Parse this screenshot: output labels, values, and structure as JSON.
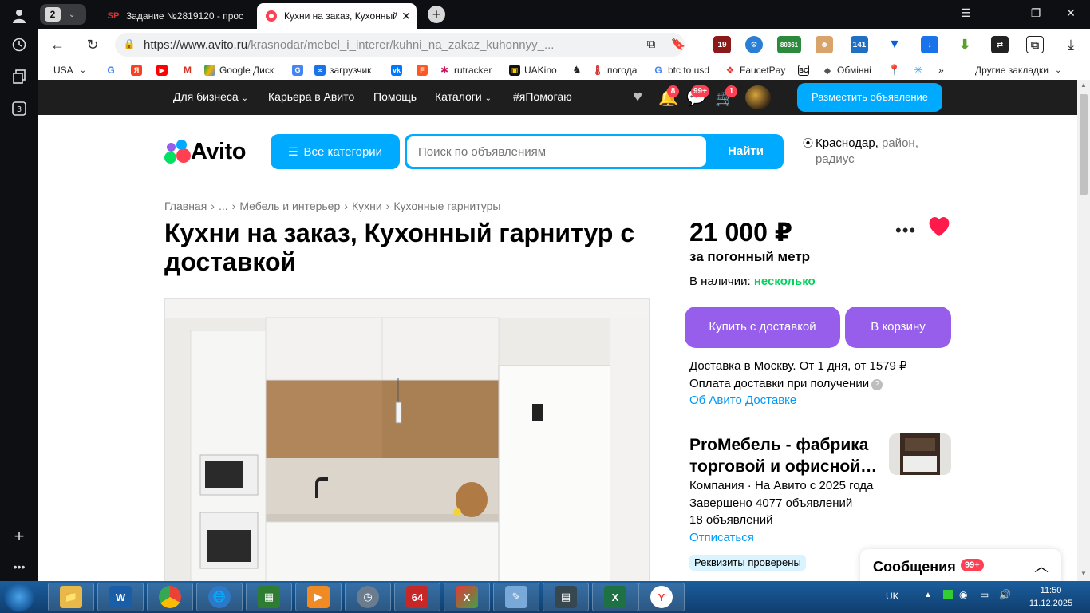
{
  "browser": {
    "tab_count": "2",
    "tabs": [
      {
        "favicon": "SP",
        "title": "Задание №2819120 - прос"
      },
      {
        "favicon": "avito-favicon",
        "title": "Кухни на заказ, Кухонный"
      }
    ],
    "url_host": "https://www.avito.ru",
    "url_path": "/krasnodar/mebel_i_interer/kuhni_na_zakaz_kuhonnyy_...",
    "ext_badges": [
      "19",
      "80361",
      "141"
    ],
    "bookmarks": [
      {
        "label": "USA",
        "icon": "flag-icon"
      },
      {
        "label": "",
        "icon": "google-icon"
      },
      {
        "label": "",
        "icon": "yandex-icon"
      },
      {
        "label": "",
        "icon": "youtube-icon"
      },
      {
        "label": "",
        "icon": "gmail-icon"
      },
      {
        "label": "Google Диск",
        "icon": "drive-icon"
      },
      {
        "label": "",
        "icon": "translate-icon"
      },
      {
        "label": "загрузчик",
        "icon": "download-icon"
      },
      {
        "label": "",
        "icon": "vk-icon"
      },
      {
        "label": "",
        "icon": "f-icon"
      },
      {
        "label": "rutracker",
        "icon": "rutracker-icon"
      },
      {
        "label": "UAKino",
        "icon": "uakino-icon"
      },
      {
        "label": "",
        "icon": "chess-icon"
      },
      {
        "label": "погода",
        "icon": "thermometer-icon"
      },
      {
        "label": "btc to usd",
        "icon": "google-icon"
      },
      {
        "label": "FaucetPay",
        "icon": "faucetpay-icon"
      },
      {
        "label": "",
        "icon": "bc-icon"
      },
      {
        "label": "Обмінні",
        "icon": "exchange-icon"
      },
      {
        "label": "",
        "icon": "maps-icon"
      },
      {
        "label": "",
        "icon": "star-icon"
      }
    ],
    "bookmarks_more": "»",
    "other_bookmarks": "Другие закладки"
  },
  "topnav": {
    "items": [
      "Для бизнеса",
      "Карьера в Авито",
      "Помощь",
      "Каталоги",
      "#яПомогаю"
    ],
    "badges": {
      "notifications": "8",
      "messages": "99+",
      "cart": "1"
    },
    "post_button": "Разместить объявление"
  },
  "header": {
    "logo_text": "Avito",
    "categories_button": "Все категории",
    "search_placeholder": "Поиск по объявлениям",
    "search_button": "Найти",
    "location_city": "Краснодар,",
    "location_rest": "район,",
    "location_radius": "радиус"
  },
  "breadcrumbs": [
    "Главная",
    "...",
    "Мебель и интерьер",
    "Кухни",
    "Кухонные гарнитуры"
  ],
  "listing": {
    "title": "Кухни на заказ, Кухонный гарнитур с доставкой",
    "price": "21 000 ₽",
    "price_unit": "за погонный метр",
    "stock_label": "В наличии:",
    "stock_value": "несколько",
    "buy_button": "Купить с доставкой",
    "cart_button": "В корзину",
    "delivery_line1": "Доставка в Москву. От 1 дня, от 1579 ₽",
    "delivery_line2": "Оплата доставки при получении",
    "delivery_link": "Об Авито Доставке"
  },
  "seller": {
    "name": "ProМебель - фабрика торговой и офисной…",
    "info1": "Компания · На Авито с 2025 года",
    "info2": "Завершено 4077 объявлений",
    "info3": "18 объявлений",
    "unsubscribe": "Отписаться",
    "verified": "Реквизиты проверены"
  },
  "messages_panel": {
    "label": "Сообщения",
    "badge": "99+"
  },
  "taskbar": {
    "apps": [
      "explorer-icon",
      "wise-icon",
      "chrome-icon",
      "network-icon",
      "calculator-icon",
      "media-icon",
      "clock-icon",
      "64-icon",
      "xapp-icon",
      "notepad-icon",
      "terminal-icon",
      "excel-icon",
      "yandex-browser-icon"
    ],
    "app_64_label": "64",
    "language": "UK",
    "time": "11:50",
    "date": "11.12.2025"
  },
  "colors": {
    "avito_blue": "#00aaff",
    "avito_purple": "#965eeb",
    "avito_green": "#02d15c",
    "badge_red": "#ff4053",
    "heart_red": "#ff1a4b"
  }
}
